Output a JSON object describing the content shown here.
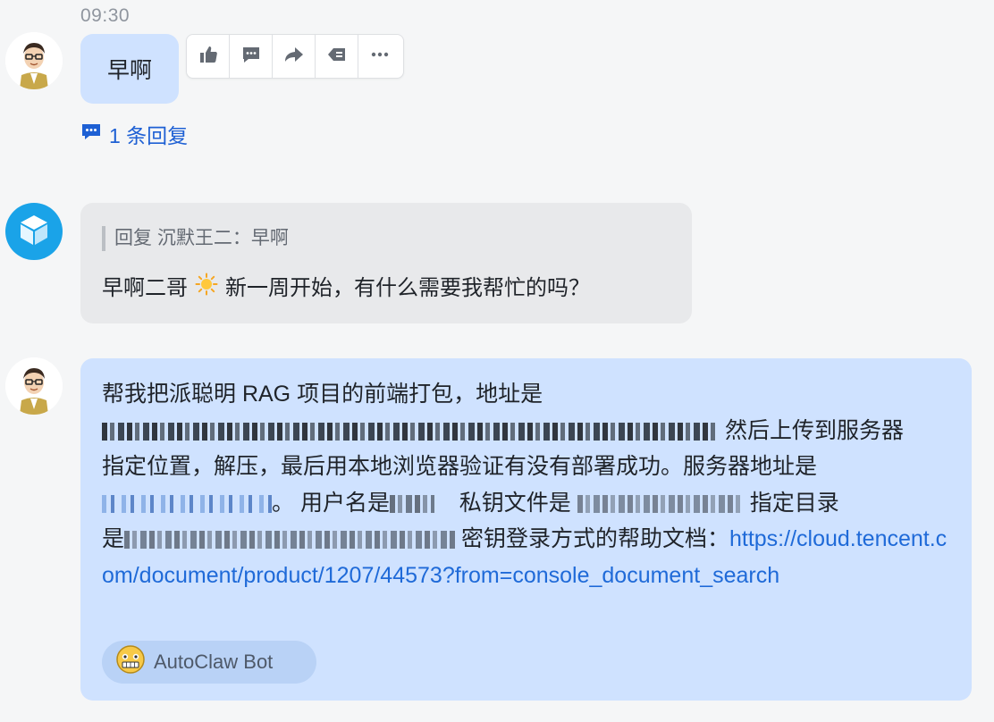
{
  "messages": {
    "time": "09:30",
    "first": {
      "text": "早啊",
      "reply_count": "1 条回复"
    },
    "toolbar": {
      "icons": [
        "thumbs-up-icon",
        "comment-icon",
        "forward-icon",
        "reply-icon",
        "more-icon"
      ]
    },
    "bot_reply": {
      "quote": "回复 沉默王二：早啊",
      "text_before": "早啊二哥",
      "emoji": "sun",
      "text_after": "新一周开始，有什么需要我帮忙的吗？"
    },
    "request": {
      "line1": "帮我把派聪明 RAG 项目的前端打包，地址是",
      "after_addr": "然后上传到服务器",
      "line3": "指定位置，解压，最后用本地浏览器验证有没有部署成功。服务器地址是",
      "user_label": "用户名是",
      "key_label": "私钥文件是",
      "dir_label": "指定目录",
      "dir_prefix": "是",
      "doc_label": "密钥登录方式的帮助文档：",
      "doc_link": "https://cloud.tencent.com/document/product/1207/44573?from=console_document_search"
    },
    "bot_chip": {
      "label": "AutoClaw Bot"
    }
  },
  "colors": {
    "background": "#f5f6f7",
    "my_bubble": "#cfe2ff",
    "bot_bubble": "#e8e9eb",
    "link": "#1f6ad8"
  }
}
